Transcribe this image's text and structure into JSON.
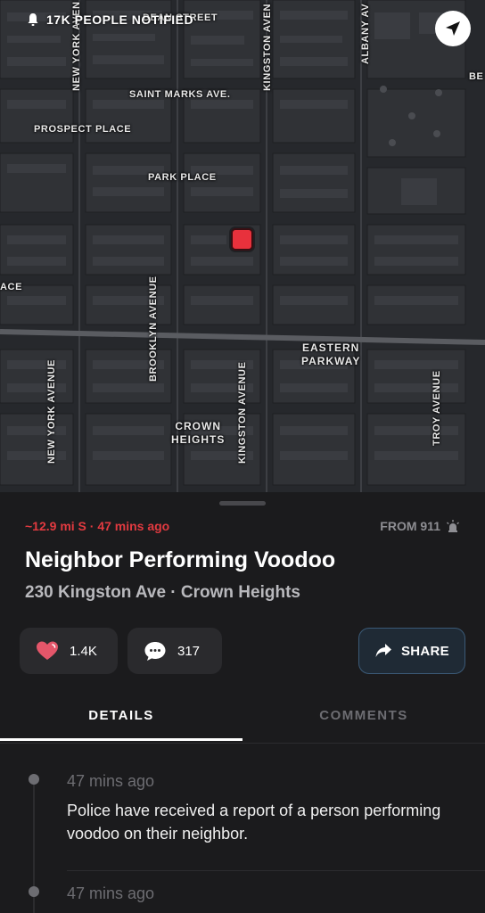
{
  "map": {
    "streets": {
      "dean_street": "DEAN STREET",
      "new_york_avenue_top": "NEW YORK AVEN",
      "kingston_avenue_top": "KINGSTON AVEN",
      "albany_avenue": "ALBANY AV",
      "saint_marks": "SAINT MARKS AVE.",
      "prospect_place": "PROSPECT PLACE",
      "park_place": "PARK PLACE",
      "place_left": "ACE",
      "brooklyn_avenue": "BROOKLYN AVENUE",
      "eastern_parkway_1": "EASTERN",
      "eastern_parkway_2": "PARKWAY",
      "new_york_avenue": "NEW YORK AVENUE",
      "kingston_avenue": "KINGSTON AVENUE",
      "troy_avenue": "TROY AVENUE",
      "crown_heights_1": "CROWN",
      "crown_heights_2": "HEIGHTS",
      "right_edge": "BE"
    },
    "notified_text": "17K PEOPLE NOTIFIED",
    "marker_color": "#e8313c"
  },
  "incident": {
    "distance": "~12.9 mi S · 47 mins ago",
    "source": "FROM 911",
    "title": "Neighbor Performing Voodoo",
    "address": "230 Kingston Ave · Crown Heights"
  },
  "actions": {
    "likes": "1.4K",
    "comments": "317",
    "share": "SHARE"
  },
  "tabs": {
    "details": "DETAILS",
    "comments": "COMMENTS"
  },
  "updates": [
    {
      "time": "47 mins ago",
      "text": "Police have received a report of a person performing voodoo on their neighbor."
    },
    {
      "time": "47 mins ago",
      "text": ""
    }
  ],
  "colors": {
    "accent_red": "#e23a40",
    "heart": "#e4566a",
    "share_border": "#3b5a77"
  }
}
